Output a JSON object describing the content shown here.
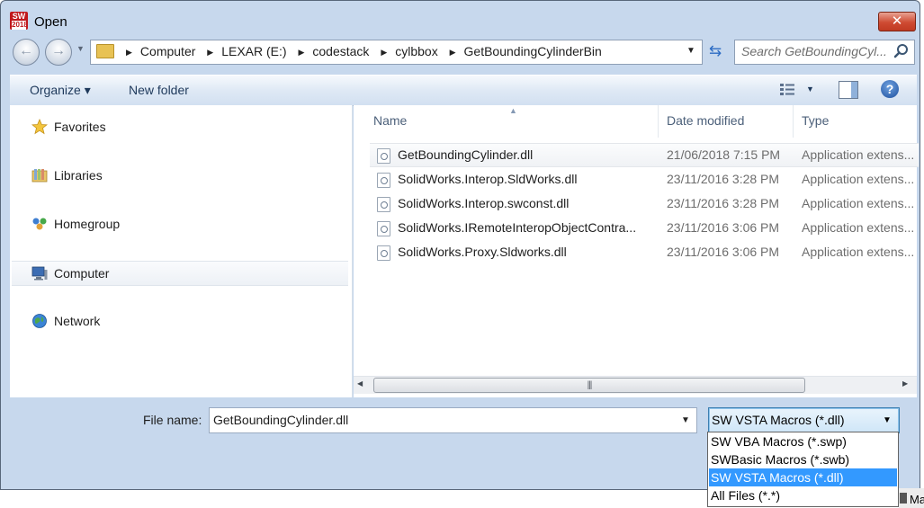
{
  "window": {
    "title": "Open",
    "app_icon_text": "SW",
    "app_icon_sub": "2018",
    "close_label": "✕"
  },
  "navigation": {
    "back_glyph": "←",
    "forward_glyph": "→",
    "breadcrumbs": [
      "Computer",
      "LEXAR (E:)",
      "codestack",
      "cylbbox",
      "GetBoundingCylinderBin"
    ],
    "search_placeholder": "Search GetBoundingCyl..."
  },
  "toolbar": {
    "organize_label": "Organize ▾",
    "new_folder_label": "New folder",
    "help_label": "?"
  },
  "nav_pane": {
    "items": [
      {
        "label": "Favorites",
        "icon": "star-icon"
      },
      {
        "label": "Libraries",
        "icon": "libraries-icon"
      },
      {
        "label": "Homegroup",
        "icon": "homegroup-icon"
      },
      {
        "label": "Computer",
        "icon": "computer-icon"
      },
      {
        "label": "Network",
        "icon": "network-icon"
      }
    ]
  },
  "file_list": {
    "columns": [
      "Name",
      "Date modified",
      "Type"
    ],
    "rows": [
      {
        "name": "GetBoundingCylinder.dll",
        "date": "21/06/2018 7:15 PM",
        "type": "Application extens..."
      },
      {
        "name": "SolidWorks.Interop.SldWorks.dll",
        "date": "23/11/2016 3:28 PM",
        "type": "Application extens..."
      },
      {
        "name": "SolidWorks.Interop.swconst.dll",
        "date": "23/11/2016 3:28 PM",
        "type": "Application extens..."
      },
      {
        "name": "SolidWorks.IRemoteInteropObjectContra...",
        "date": "23/11/2016 3:06 PM",
        "type": "Application extens..."
      },
      {
        "name": "SolidWorks.Proxy.Sldworks.dll",
        "date": "23/11/2016 3:06 PM",
        "type": "Application extens..."
      }
    ],
    "selected_index": 0
  },
  "bottom": {
    "filename_label": "File name:",
    "filename_value": "GetBoundingCylinder.dll",
    "filetype_value": "SW VSTA Macros (*.dll)",
    "filetype_options": [
      "SW VBA Macros (*.swp)",
      "SWBasic Macros (*.swb)",
      "SW VSTA Macros (*.dll)",
      "All Files (*.*)"
    ],
    "filetype_selected_index": 2
  },
  "background": {
    "taskbar_label": "Ma"
  },
  "colors": {
    "frame": "#c7d8ed",
    "selection": "#3399ff",
    "link_text": "#1e395b"
  }
}
